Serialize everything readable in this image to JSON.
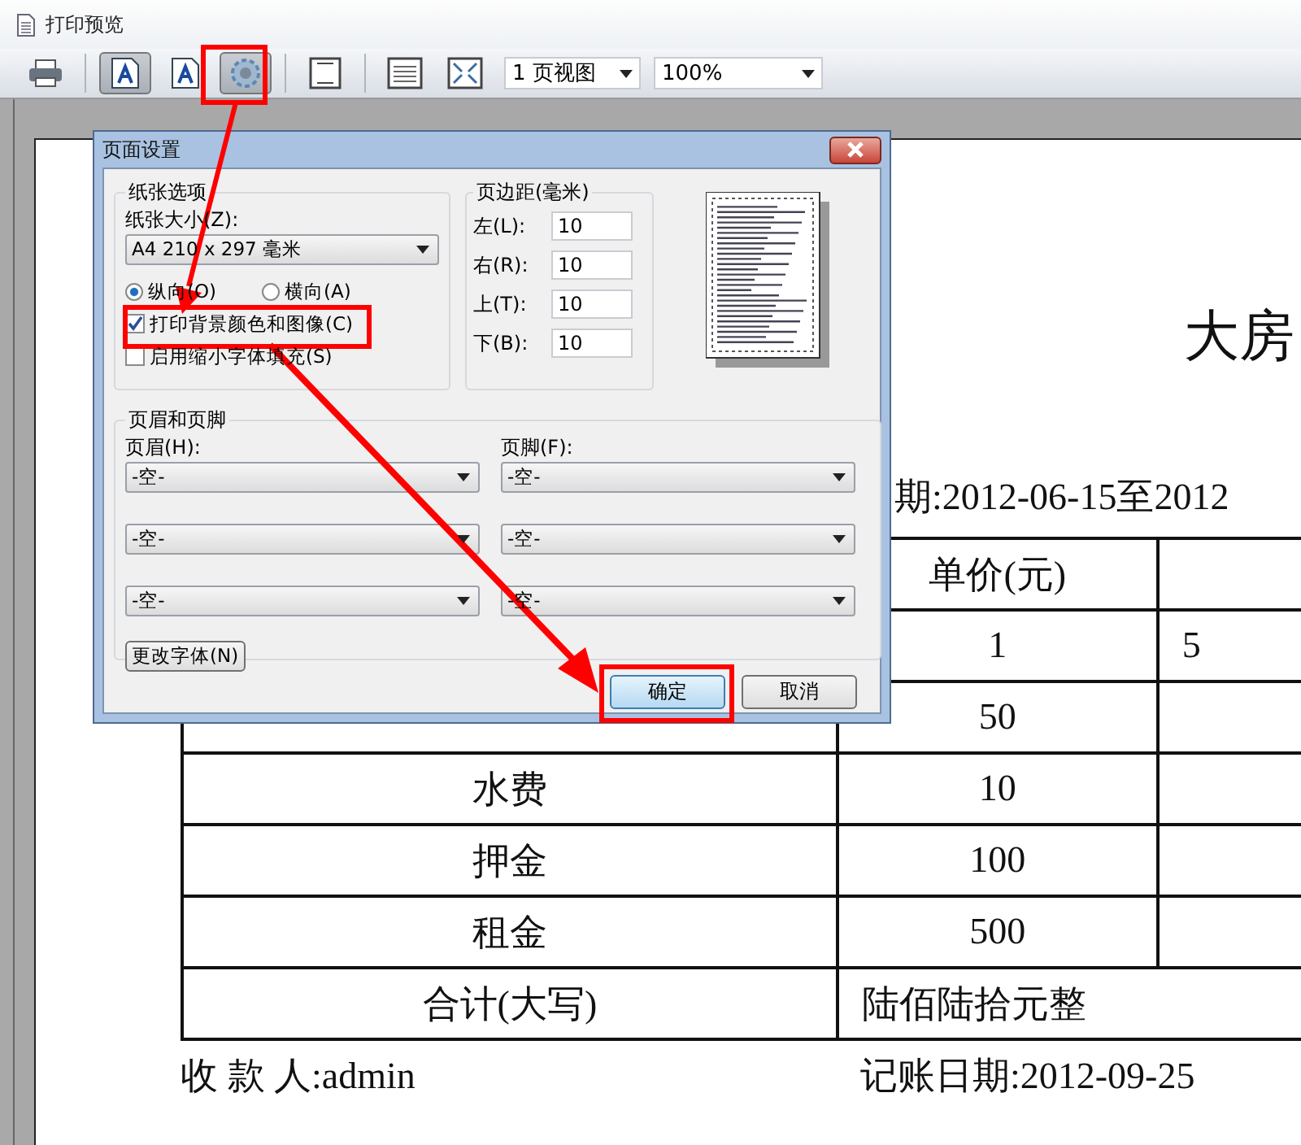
{
  "window": {
    "title": "打印预览"
  },
  "toolbar": {
    "buttons": [
      {
        "kind": "print",
        "pressed": false
      },
      {
        "kind": "portrait",
        "pressed": true
      },
      {
        "kind": "landscape",
        "pressed": false
      },
      {
        "kind": "setup",
        "pressed": true
      },
      {
        "kind": "single",
        "pressed": false
      },
      {
        "kind": "fit-width",
        "pressed": false
      },
      {
        "kind": "fit-page",
        "pressed": false
      }
    ],
    "selects": [
      {
        "value": "1 页视图"
      },
      {
        "value": "100%"
      }
    ]
  },
  "document": {
    "title": "大房",
    "date_line": "期:2012-06-15至2012",
    "table": {
      "header_price": "单价(元)",
      "rows": [
        {
          "price": "1",
          "column_3": "5"
        },
        {
          "price": "50"
        },
        {
          "item": "水费",
          "price": "10"
        },
        {
          "item": "押金",
          "price": "100"
        },
        {
          "item": "租金",
          "price": "500"
        }
      ],
      "total": {
        "label": "合计(大写)",
        "amount": "陆佰陆拾元整"
      }
    },
    "payee": "收 款 人:admin",
    "date": "记账日期:2012-09-25"
  },
  "dialog": {
    "title": "页面设置",
    "paper": {
      "legend": "纸张选项",
      "size_label": "纸张大小(Z):",
      "size_value": "A4 210 x 297 毫米",
      "orientation": [
        {
          "label": "纵向(O)",
          "selected": true
        },
        {
          "label": "横向(A)",
          "selected": false
        }
      ],
      "options": [
        {
          "label": "打印背景颜色和图像(C)",
          "checked": true
        },
        {
          "label": "启用缩小字体填充(S)",
          "checked": false
        }
      ]
    },
    "margins": {
      "legend": "页边距(毫米)",
      "fields": [
        {
          "label": "左(L):",
          "value": "10"
        },
        {
          "label": "右(R):",
          "value": "10"
        },
        {
          "label": "上(T):",
          "value": "10"
        },
        {
          "label": "下(B):",
          "value": "10"
        }
      ]
    },
    "header_footer": {
      "legend": "页眉和页脚",
      "header_label": "页眉(H):",
      "footer_label": "页脚(F):",
      "headers": [
        "-空-",
        "-空-",
        "-空-"
      ],
      "footers": [
        "-空-",
        "-空-",
        "-空-"
      ],
      "font_button": "更改字体(N)"
    },
    "buttons": [
      {
        "label": "确定",
        "default": true
      },
      {
        "label": "取消",
        "default": false
      }
    ]
  }
}
